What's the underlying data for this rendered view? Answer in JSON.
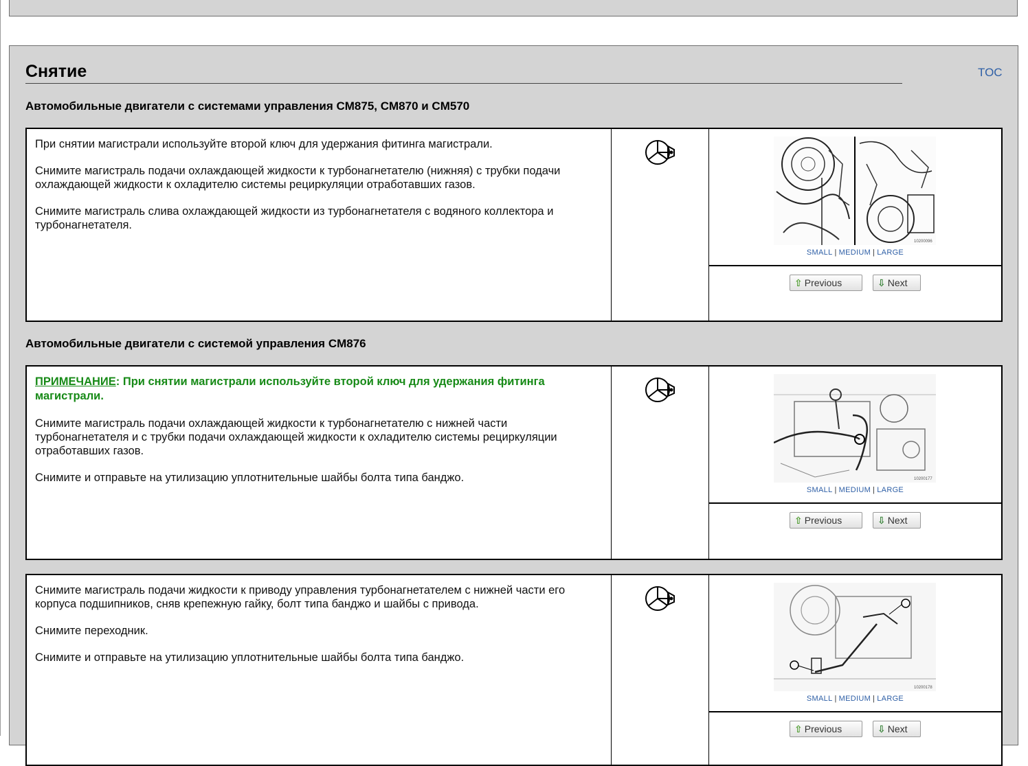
{
  "section": {
    "title": "Снятие",
    "toc_label": "TOC"
  },
  "groups": [
    {
      "heading": "Автомобильные двигатели с системами управления CM875, CM870 и CM570"
    },
    {
      "heading": "Автомобильные двигатели с системой управления CM876"
    }
  ],
  "steps": [
    {
      "paragraphs": [
        "При снятии магистрали используйте второй ключ для удержания фитинга магистрали.",
        "Снимите магистраль подачи охлаждающей жидкости к турбонагнетателю (нижняя) с трубки подачи охлаждающей жидкости к охладителю системы рециркуляции отработавших газов.",
        "Снимите магистраль слива охлаждающей жидкости из турбонагнетателя с водяного коллектора и турбонагнетателя."
      ],
      "tool_icon": "wrench-tool-icon",
      "image_code": "10200096"
    },
    {
      "note_label": "ПРИМЕЧАНИЕ",
      "note_text": ": При снятии магистрали используйте второй ключ для удержания фитинга магистрали.",
      "paragraphs": [
        "Снимите магистраль подачи охлаждающей жидкости к турбонагнетателю с нижней части турбонагнетателя и с трубки подачи охлаждающей жидкости к охладителю системы рециркуляции отработавших газов.",
        "Снимите и отправьте на утилизацию уплотнительные шайбы болта типа банджо."
      ],
      "tool_icon": "wrench-tool-icon",
      "image_code": "10200177"
    },
    {
      "paragraphs": [
        "Снимите магистраль подачи жидкости к приводу управления турбонагнетателем с нижней части его корпуса подшипников, сняв крепежную гайку, болт типа банджо и шайбы с привода.",
        "Снимите переходник.",
        "Снимите и отправьте на утилизацию уплотнительные шайбы болта типа банджо."
      ],
      "tool_icon": "wrench-tool-icon",
      "image_code": "10200178"
    }
  ],
  "image_sizes": {
    "small": "SMALL",
    "medium": "MEDIUM",
    "large": "LARGE",
    "separator": "|"
  },
  "nav": {
    "previous": "Previous",
    "next": "Next",
    "previous_arrow": "⇧",
    "next_arrow": "⇩"
  },
  "colors": {
    "panel_bg": "#d4d4d4",
    "link": "#2e5fa6",
    "note": "#178a17"
  }
}
